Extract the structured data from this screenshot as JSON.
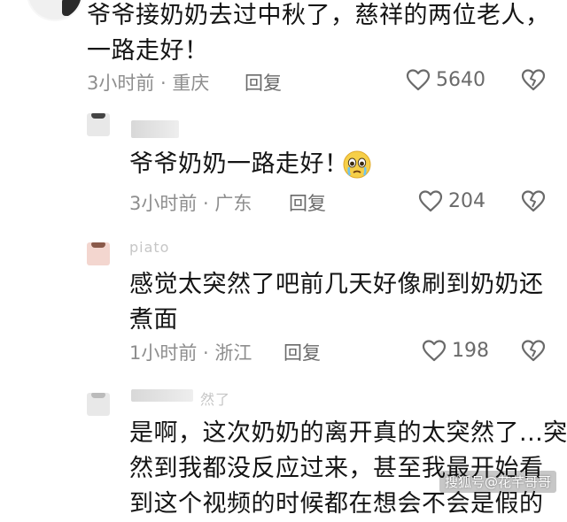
{
  "comments": [
    {
      "content_lines": [
        "爷爷接奶奶去过中秋了，慈祥的两位老人，",
        "一路走好！"
      ],
      "time": "3小时前",
      "location": "重庆",
      "reply_label": "回复",
      "likes": "5640"
    },
    {
      "content_lines": [
        "爷爷奶奶一路走好！"
      ],
      "emoji": "crying-face-emoji",
      "time": "3小时前",
      "location": "广东",
      "reply_label": "回复",
      "likes": "204"
    },
    {
      "username_fragment": "piato",
      "content_lines": [
        "感觉太突然了吧前几天好像刷到奶奶还",
        "煮面"
      ],
      "time": "1小时前",
      "location": "浙江",
      "reply_label": "回复",
      "likes": "198"
    },
    {
      "username_fragment": "然了",
      "content_lines": [
        "是啊，这次奶奶的离开真的太突然了...突",
        "然到我都没反应过来，甚至我最开始看",
        "到这个视频的时候都在想会不会是假的"
      ]
    }
  ],
  "separator": " · ",
  "watermark": "搜狐号@花芊哥哥",
  "icons": {
    "like": "heart-outline-icon",
    "dislike": "broken-heart-icon"
  },
  "colors": {
    "text": "#141414",
    "meta": "#8e8e8e",
    "icon": "#6a6a6a"
  }
}
